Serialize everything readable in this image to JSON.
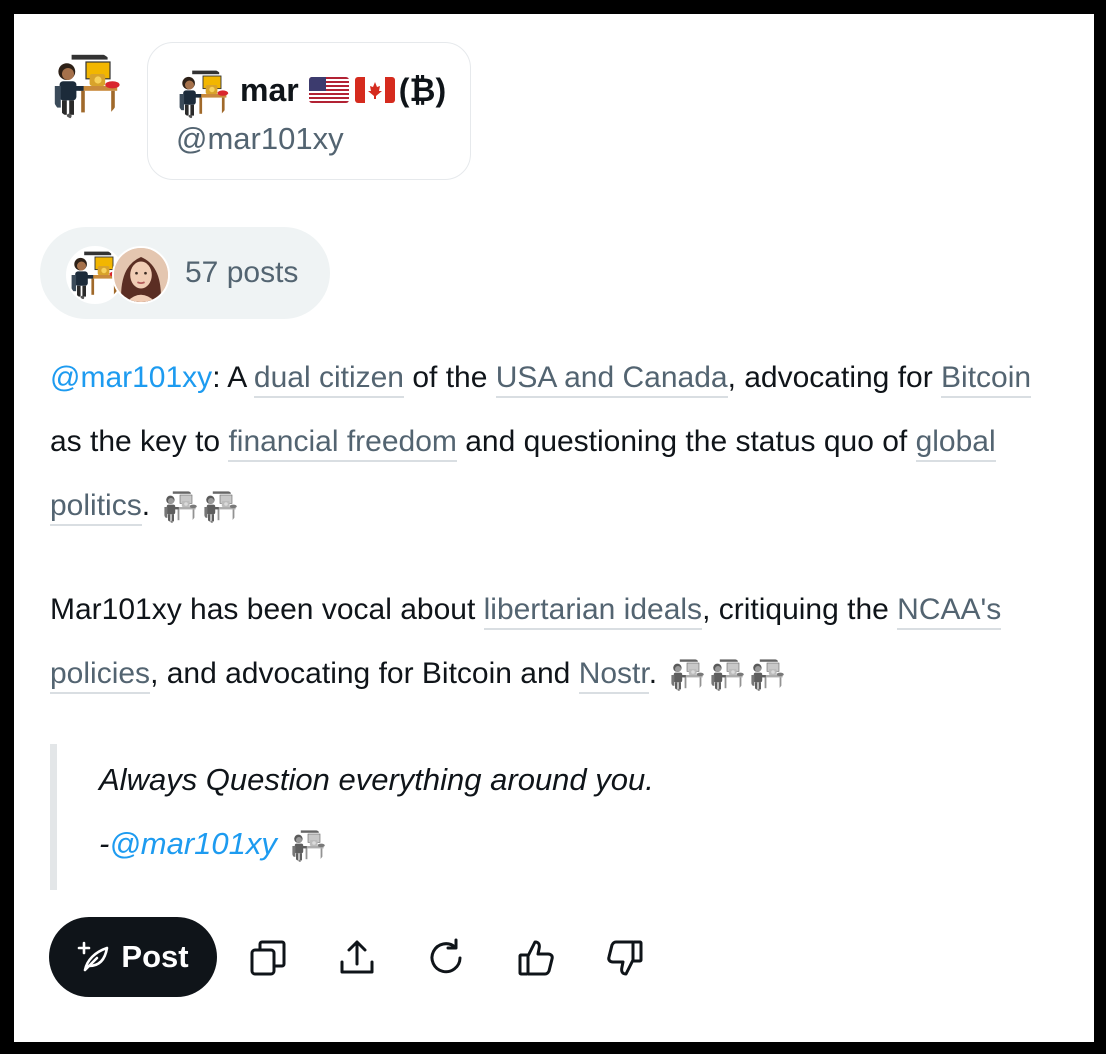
{
  "author": {
    "name": "mar",
    "flags": [
      "us-flag",
      "canada-flag"
    ],
    "name_suffix": "(₿)",
    "handle": "@mar101xy"
  },
  "posts_pill": {
    "label": "57 posts"
  },
  "body": {
    "paragraph1": {
      "mention": "@mar101xy",
      "t1": ": A ",
      "term1": "dual citizen",
      "t2": " of the ",
      "term2": "USA and Canada",
      "t3": ", advocating for ",
      "term3": "Bitcoin",
      "t4": " as the key to ",
      "term4": "financial freedom",
      "t5": " and questioning the status quo of ",
      "term5": "global politics",
      "t6": "."
    },
    "paragraph2": {
      "t1": "Mar101xy has been vocal about ",
      "term1": "libertarian ideals",
      "t2": ", critiquing the ",
      "term2": "NCAA's policies",
      "t3": ", and advocating for Bitcoin and ",
      "term3": "Nostr",
      "t4": "."
    },
    "quote": {
      "text": "Always Question everything around you.",
      "dash": "-",
      "mention": "@mar101xy"
    }
  },
  "actions": {
    "post_label": "Post",
    "icons": [
      "post-compose-icon",
      "copy-icon",
      "share-icon",
      "regenerate-icon",
      "thumbs-up-icon",
      "thumbs-down-icon"
    ]
  },
  "colors": {
    "mention": "#1d9bf0",
    "term": "#536471",
    "button_bg": "#0f1419",
    "pill_bg": "#eff3f4"
  }
}
